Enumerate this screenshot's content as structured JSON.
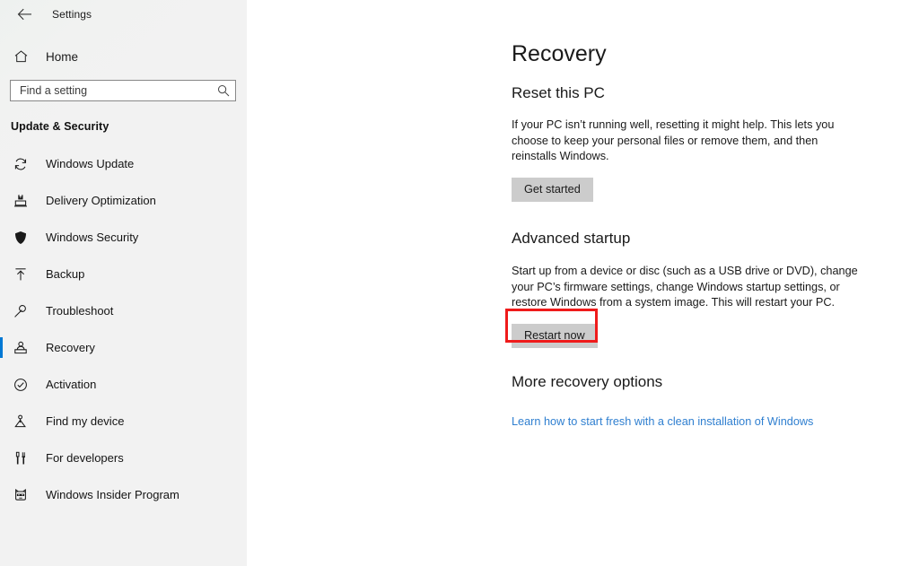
{
  "window": {
    "back_icon": "back-arrow-icon",
    "title": "Settings"
  },
  "sidebar": {
    "home": {
      "label": "Home",
      "icon": "home-icon"
    },
    "search": {
      "value": "",
      "placeholder": "Find a setting",
      "icon": "search-icon"
    },
    "group_title": "Update & Security",
    "selected_index": 5,
    "accent_color": "#0078d4",
    "items": [
      {
        "label": "Windows Update",
        "icon": "sync-icon"
      },
      {
        "label": "Delivery Optimization",
        "icon": "upload-box-icon"
      },
      {
        "label": "Windows Security",
        "icon": "shield-icon"
      },
      {
        "label": "Backup",
        "icon": "upload-arrow-icon"
      },
      {
        "label": "Troubleshoot",
        "icon": "wrench-icon"
      },
      {
        "label": "Recovery",
        "icon": "recovery-icon"
      },
      {
        "label": "Activation",
        "icon": "check-circle-icon"
      },
      {
        "label": "Find my device",
        "icon": "location-person-icon"
      },
      {
        "label": "For developers",
        "icon": "tools-icon"
      },
      {
        "label": "Windows Insider Program",
        "icon": "ninja-cat-icon"
      }
    ]
  },
  "main": {
    "page_title": "Recovery",
    "sections": [
      {
        "heading": "Reset this PC",
        "body": "If your PC isn’t running well, resetting it might help. This lets you choose to keep your personal files or remove them, and then reinstalls Windows.",
        "button": "Get started"
      },
      {
        "heading": "Advanced startup",
        "body": "Start up from a device or disc (such as a USB drive or DVD), change your PC’s firmware settings, change Windows startup settings, or restore Windows from a system image. This will restart your PC.",
        "button": "Restart now"
      },
      {
        "heading": "More recovery options",
        "link": "Learn how to start fresh with a clean installation of Windows"
      }
    ]
  },
  "annotation": {
    "highlight_color": "#ef1b1b",
    "target": "Restart now"
  }
}
